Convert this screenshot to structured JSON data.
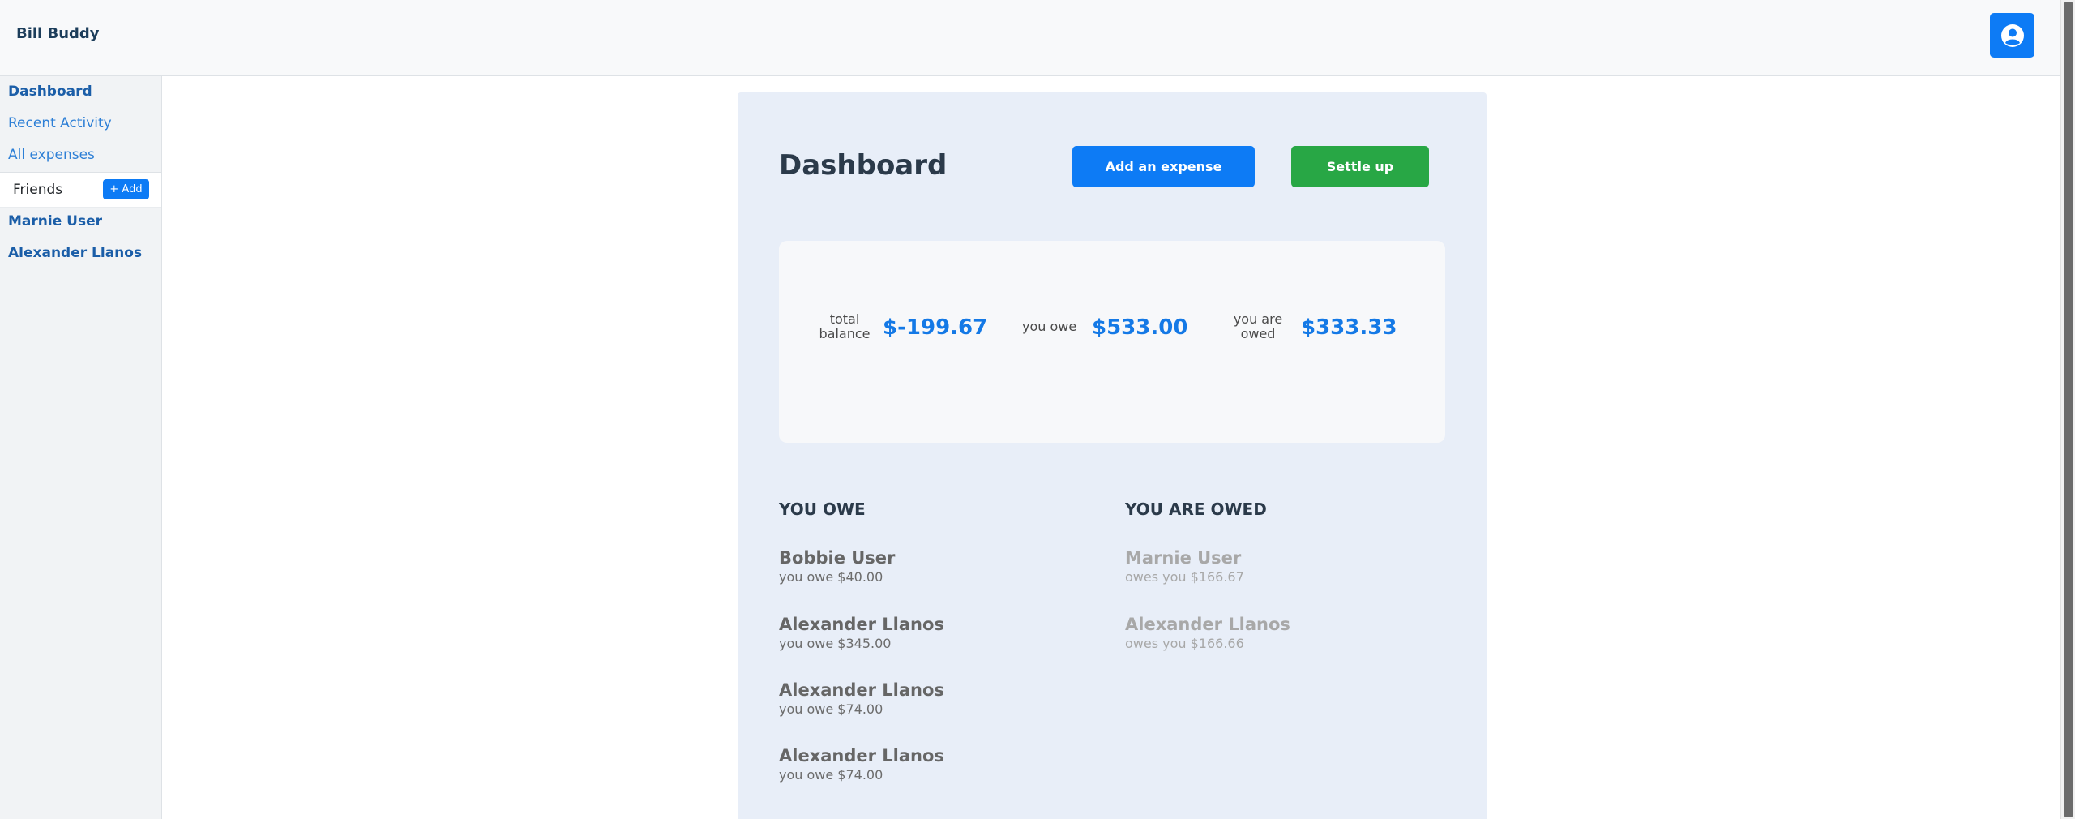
{
  "header": {
    "brand": "Bill Buddy",
    "profile_icon": "user-circle-icon"
  },
  "sidebar": {
    "links": [
      {
        "label": "Dashboard",
        "active": true
      },
      {
        "label": "Recent Activity",
        "active": false
      },
      {
        "label": "All expenses",
        "active": false
      }
    ],
    "friends_label": "Friends",
    "add_label": "+ Add",
    "friends": [
      "Marnie User",
      "Alexander Llanos"
    ]
  },
  "main": {
    "title": "Dashboard",
    "add_expense_label": "Add an expense",
    "settle_up_label": "Settle up",
    "summary": {
      "total_balance_label_1": "total",
      "total_balance_label_2": "balance",
      "total_balance_value": "$-199.67",
      "you_owe_label": "you owe",
      "you_owe_value": "$533.00",
      "you_are_owed_label_1": "you are",
      "you_are_owed_label_2": "owed",
      "you_are_owed_value": "$333.33"
    },
    "you_owe_title": "YOU OWE",
    "you_owe_list": [
      {
        "name": "Bobbie User",
        "detail": "you owe $40.00"
      },
      {
        "name": "Alexander Llanos",
        "detail": "you owe $345.00"
      },
      {
        "name": "Alexander Llanos",
        "detail": "you owe $74.00"
      },
      {
        "name": "Alexander Llanos",
        "detail": "you owe $74.00"
      }
    ],
    "you_are_owed_title": "YOU ARE OWED",
    "you_are_owed_list": [
      {
        "name": "Marnie User",
        "detail": "owes you $166.67"
      },
      {
        "name": "Alexander Llanos",
        "detail": "owes you $166.66"
      }
    ]
  },
  "colors": {
    "accent": "#0d7bf5",
    "success": "#28a745",
    "panel_bg": "#e8eef8"
  }
}
